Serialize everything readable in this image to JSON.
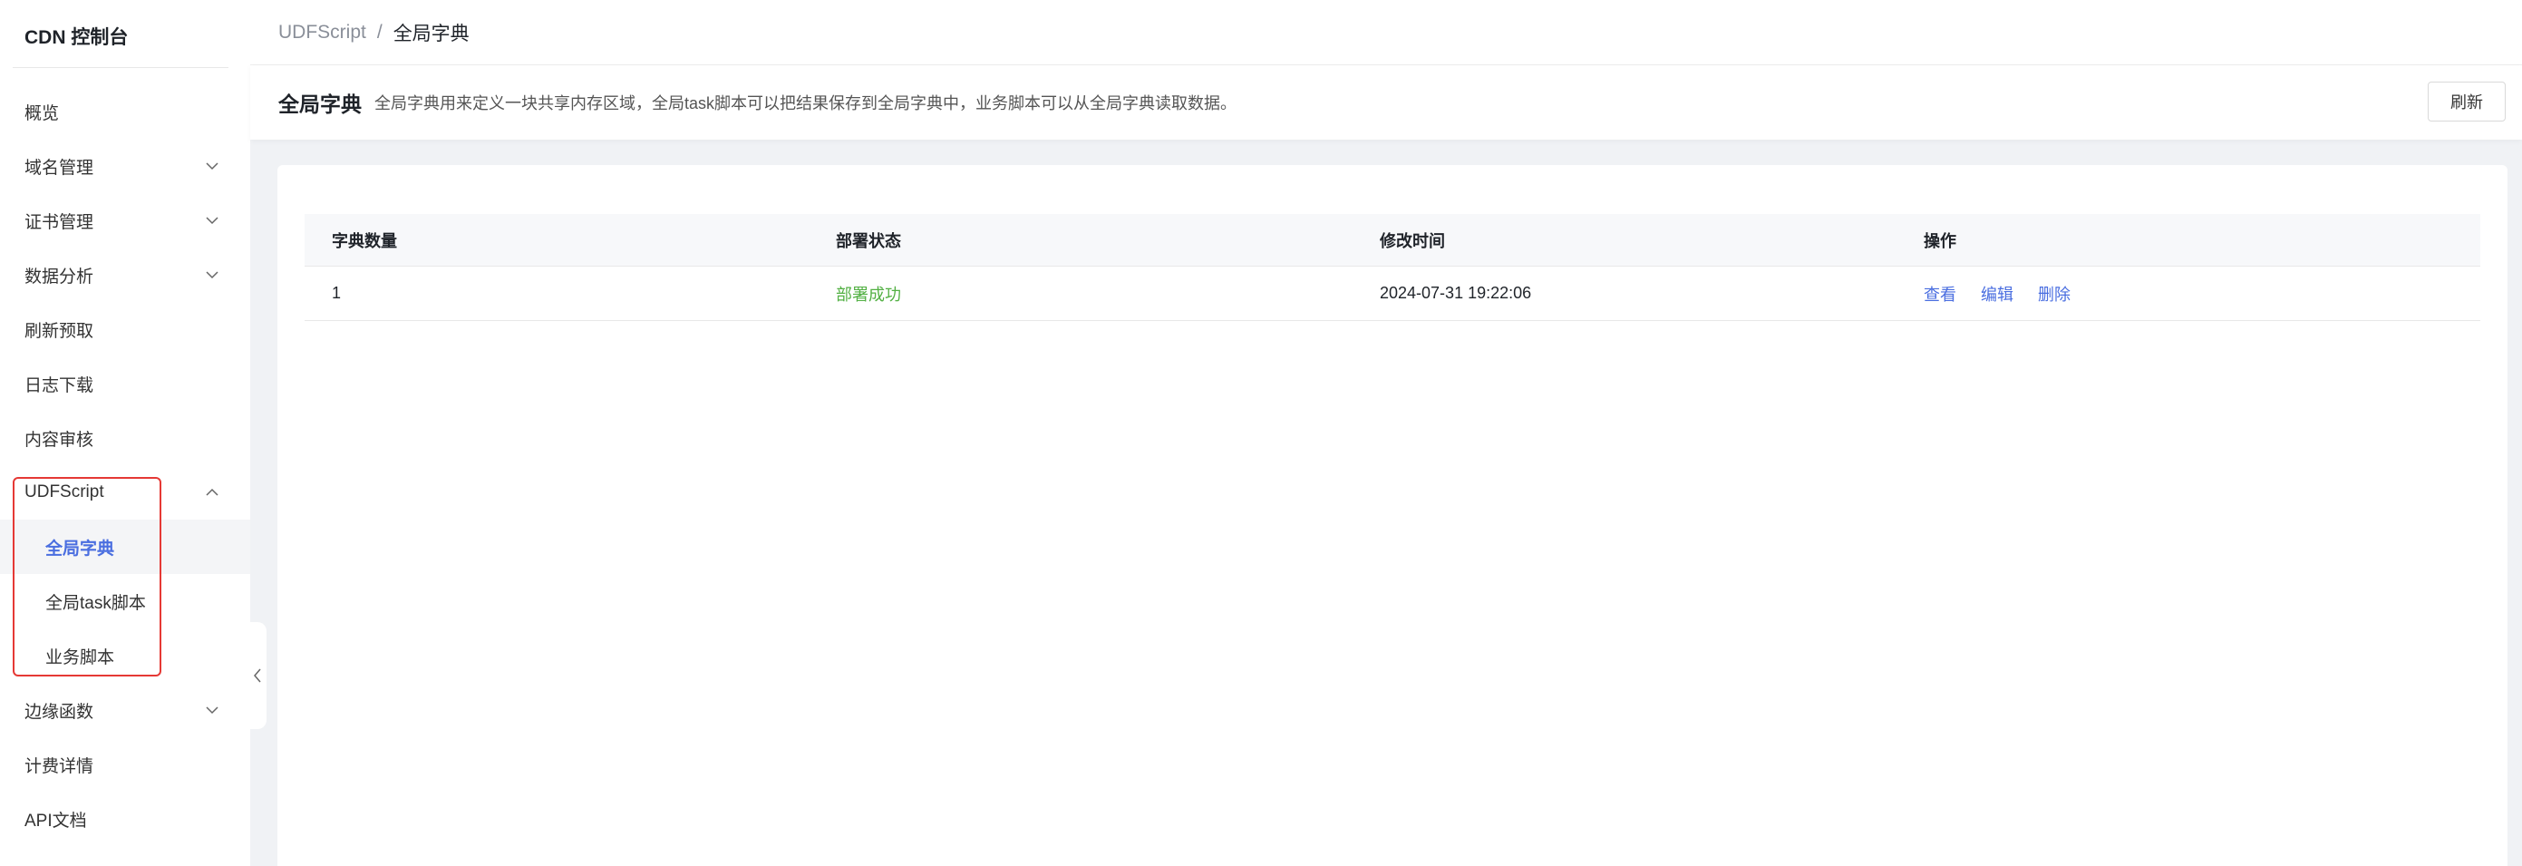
{
  "sidebar": {
    "brand": "CDN 控制台",
    "items": [
      {
        "label": "概览"
      },
      {
        "label": "域名管理"
      },
      {
        "label": "证书管理"
      },
      {
        "label": "数据分析"
      },
      {
        "label": "刷新预取"
      },
      {
        "label": "日志下载"
      },
      {
        "label": "内容审核"
      },
      {
        "label": "UDFScript"
      },
      {
        "label": "边缘函数"
      },
      {
        "label": "计费详情"
      },
      {
        "label": "API文档"
      }
    ],
    "udf_children": [
      {
        "label": "全局字典"
      },
      {
        "label": "全局task脚本"
      },
      {
        "label": "业务脚本"
      }
    ]
  },
  "breadcrumb": {
    "parent": "UDFScript",
    "separator": "/",
    "current": "全局字典"
  },
  "header": {
    "title": "全局字典",
    "description": "全局字典用来定义一块共享内存区域，全局task脚本可以把结果保存到全局字典中，业务脚本可以从全局字典读取数据。",
    "refresh_label": "刷新"
  },
  "table": {
    "columns": [
      "字典数量",
      "部署状态",
      "修改时间",
      "操作"
    ],
    "rows": [
      {
        "count": "1",
        "status": "部署成功",
        "modified": "2024-07-31 19:22:06",
        "actions": [
          "查看",
          "编辑",
          "删除"
        ]
      }
    ]
  },
  "colors": {
    "accent": "#4a6ee0",
    "success": "#52b043",
    "highlight": "#e53935"
  },
  "icons": [
    "chevron-down-icon",
    "chevron-up-icon",
    "chevron-left-icon"
  ]
}
